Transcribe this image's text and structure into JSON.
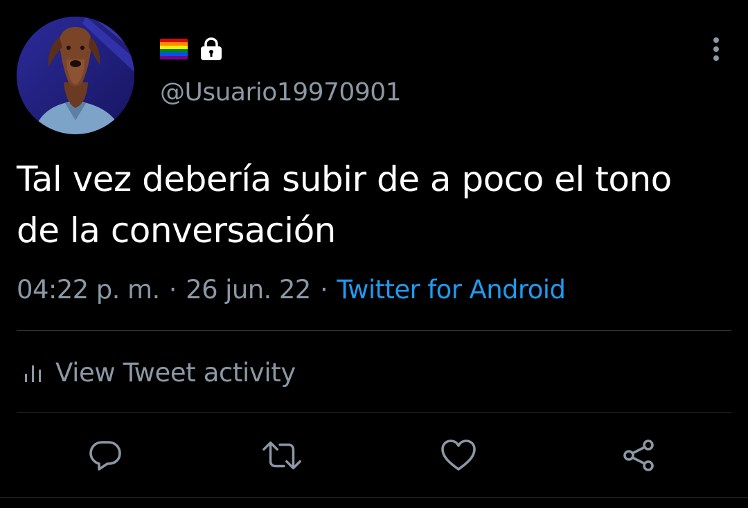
{
  "header": {
    "handle": "@Usuario19970901",
    "flag_colors": [
      "#e40303",
      "#ff8c00",
      "#ffed00",
      "#008026",
      "#004dff",
      "#750787"
    ],
    "lock_icon": "lock-icon",
    "more_icon": "more-vertical-icon"
  },
  "tweet": {
    "text_line1": "Tal vez debería subir de a poco el tono",
    "text_line2": "de la conversación",
    "time": "04:22 p. m.",
    "separator": "·",
    "date": "26 jun. 22",
    "source": "Twitter for Android"
  },
  "activity": {
    "label": "View Tweet activity",
    "icon": "bar-chart-icon"
  },
  "actions": {
    "reply_icon": "reply-icon",
    "retweet_icon": "retweet-icon",
    "like_icon": "heart-icon",
    "share_icon": "share-icon"
  },
  "colors": {
    "background": "#000000",
    "text_primary": "#ffffff",
    "text_secondary": "#8b98a5",
    "link": "#1d9bf0",
    "divider": "#2f3336"
  }
}
